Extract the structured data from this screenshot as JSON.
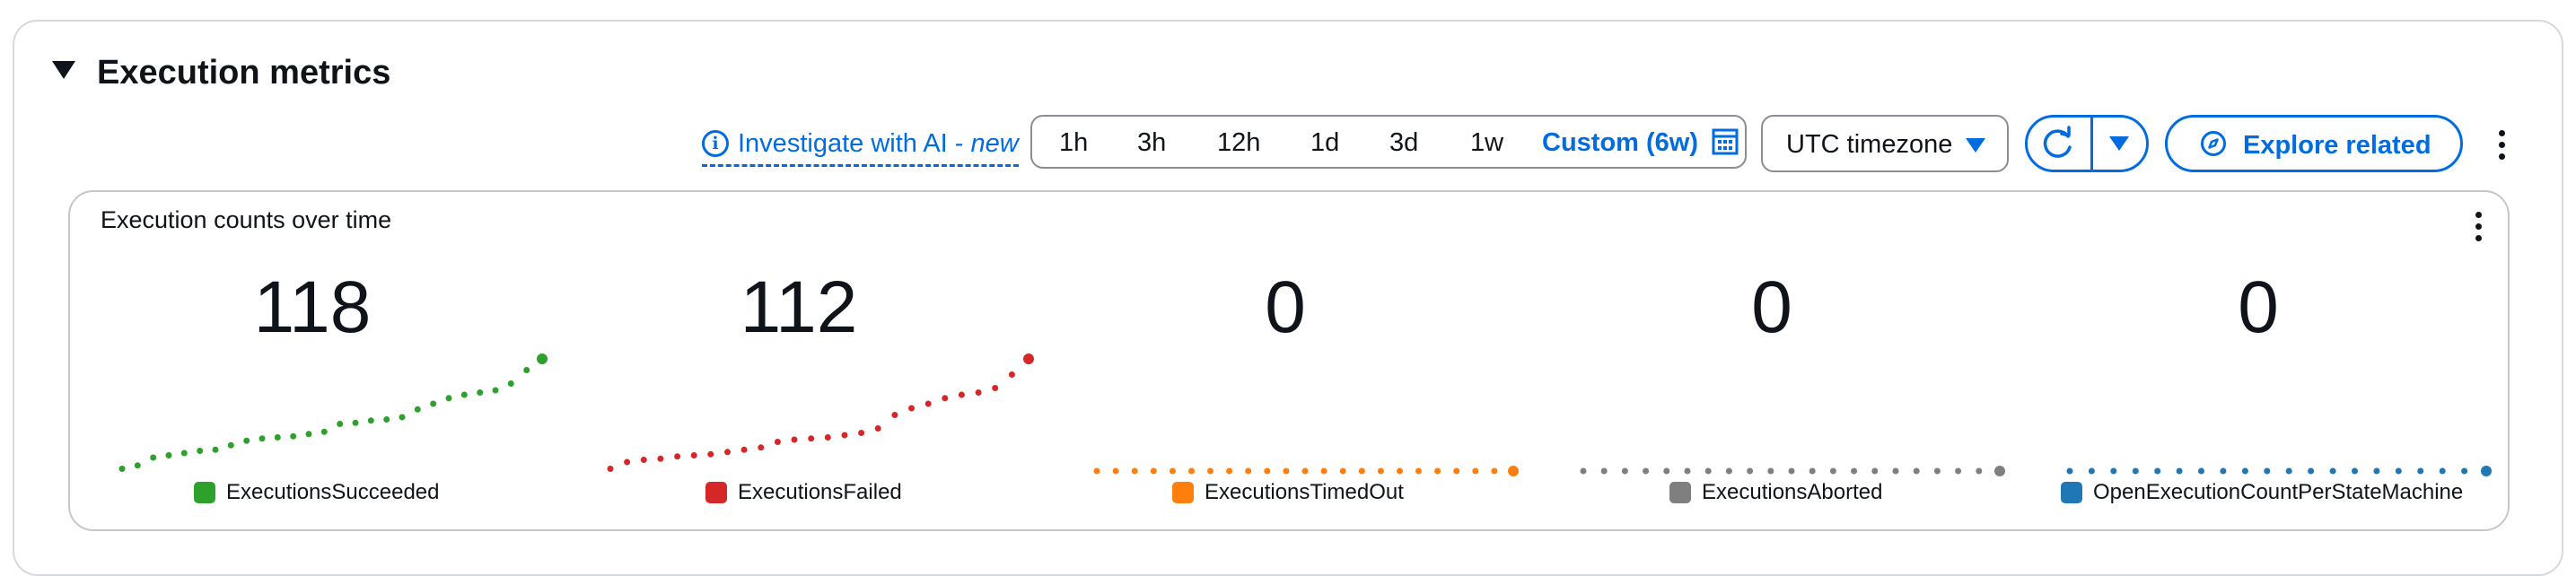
{
  "section": {
    "title": "Execution metrics"
  },
  "toolbar": {
    "investigate_label": "Investigate with AI -",
    "investigate_new": "new",
    "ranges": [
      "1h",
      "3h",
      "12h",
      "1d",
      "3d",
      "1w"
    ],
    "custom_range": "Custom (6w)",
    "timezone": "UTC timezone",
    "explore_label": "Explore related",
    "accent_color": "#006ce0"
  },
  "widget": {
    "title": "Execution counts over time"
  },
  "metrics": [
    {
      "name": "ExecutionsSucceeded",
      "value": "118",
      "color": "#2ea02c"
    },
    {
      "name": "ExecutionsFailed",
      "value": "112",
      "color": "#d62728"
    },
    {
      "name": "ExecutionsTimedOut",
      "value": "0",
      "color": "#ff7f0e"
    },
    {
      "name": "ExecutionsAborted",
      "value": "0",
      "color": "#7f7f7f"
    },
    {
      "name": "OpenExecutionCountPerStateMachine",
      "value": "0",
      "color": "#1f77b4"
    }
  ],
  "chart_data": [
    {
      "type": "scatter",
      "series": [
        {
          "name": "ExecutionsSucceeded",
          "color": "#2ea02c",
          "values": [
            0.02,
            0.05,
            0.12,
            0.14,
            0.16,
            0.18,
            0.19,
            0.23,
            0.27,
            0.29,
            0.3,
            0.31,
            0.33,
            0.35,
            0.42,
            0.43,
            0.45,
            0.46,
            0.48,
            0.55,
            0.6,
            0.65,
            0.68,
            0.7,
            0.72,
            0.78,
            0.9,
            1.0
          ]
        }
      ]
    },
    {
      "type": "scatter",
      "series": [
        {
          "name": "ExecutionsFailed",
          "color": "#d62728",
          "values": [
            0.02,
            0.08,
            0.1,
            0.11,
            0.13,
            0.14,
            0.15,
            0.17,
            0.19,
            0.21,
            0.26,
            0.28,
            0.29,
            0.3,
            0.32,
            0.34,
            0.38,
            0.5,
            0.56,
            0.6,
            0.65,
            0.68,
            0.7,
            0.74,
            0.86,
            1.0
          ]
        }
      ]
    },
    {
      "type": "scatter",
      "series": [
        {
          "name": "ExecutionsTimedOut",
          "color": "#ff7f0e",
          "values": [
            0,
            0,
            0,
            0,
            0,
            0,
            0,
            0,
            0,
            0,
            0,
            0,
            0,
            0,
            0,
            0,
            0,
            0,
            0,
            0,
            0,
            0,
            0
          ]
        }
      ]
    },
    {
      "type": "scatter",
      "series": [
        {
          "name": "ExecutionsAborted",
          "color": "#7f7f7f",
          "values": [
            0,
            0,
            0,
            0,
            0,
            0,
            0,
            0,
            0,
            0,
            0,
            0,
            0,
            0,
            0,
            0,
            0,
            0,
            0,
            0,
            0
          ]
        }
      ]
    },
    {
      "type": "scatter",
      "series": [
        {
          "name": "OpenExecutionCountPerStateMachine",
          "color": "#1f77b4",
          "values": [
            0,
            0,
            0,
            0,
            0,
            0,
            0,
            0,
            0,
            0,
            0,
            0,
            0,
            0,
            0,
            0,
            0,
            0,
            0,
            0
          ]
        }
      ]
    }
  ]
}
